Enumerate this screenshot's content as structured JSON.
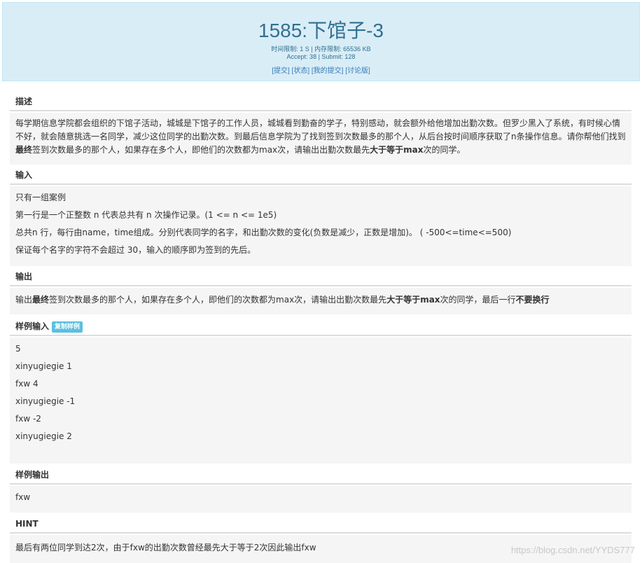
{
  "header": {
    "title": "1585:下馆子-3",
    "meta_line1": "时间限制: 1 S | 内存限制: 65536 KB",
    "meta_line2": "Accept: 38 | Submit: 128",
    "links": [
      "[提交]",
      "[状态]",
      "[我的提交]",
      "[讨论版]"
    ]
  },
  "sections": {
    "description": {
      "title": "描述",
      "text_a": "每学期信息学院都会组织的下馆子活动，城城是下馆子的工作人员，城城看到勤奋的学子，特别感动，就会额外给他增加出勤次数。但罗少黑入了系统，有时候心情不好，就会随意挑选一名同学，减少这位同学的出勤次数。到最后信息学院为了找到签到次数最多的那个人，从后台按时间顺序获取了n条操作信息。请你帮他们找到",
      "text_bold1": "最终",
      "text_b": "签到次数最多的那个人，如果存在多个人，即他们的次数都为max次，请输出出勤次数最先",
      "text_bold2": "大于等于max",
      "text_c": "次的同学。"
    },
    "input": {
      "title": "输入",
      "lines": [
        "只有一组案例",
        "第一行是一个正整数 n 代表总共有 n 次操作记录。(1 <= n <= 1e5)",
        "总共n 行，每行由name，time组成。分别代表同学的名字，和出勤次数的变化(负数是减少，正数是增加)。 ( -500<=time<=500)",
        "保证每个名字的字符不会超过 30，输入的顺序即为签到的先后。"
      ]
    },
    "output": {
      "title": "输出",
      "text_a": "输出",
      "text_bold1": "最终",
      "text_b": "签到次数最多的那个人，如果存在多个人，即他们的次数都为max次，请输出出勤次数最先",
      "text_bold2": "大于等于max",
      "text_c": "次的同学，最后一行",
      "text_bold3": "不要换行"
    },
    "sample_input": {
      "title": "样例输入",
      "copy_label": "复制样例",
      "lines": [
        "5",
        "xinyugiegie 1",
        "fxw 4",
        "xinyugiegie -1",
        "fxw -2",
        "xinyugiegie 2"
      ]
    },
    "sample_output": {
      "title": "样例输出",
      "lines": [
        "fxw"
      ]
    },
    "hint": {
      "title": "HINT",
      "text": "最后有两位同学到达2次，由于fxw的出勤次数曾经最先大于等于2次因此输出fxw"
    }
  },
  "watermark": "https://blog.csdn.net/YYDS777"
}
